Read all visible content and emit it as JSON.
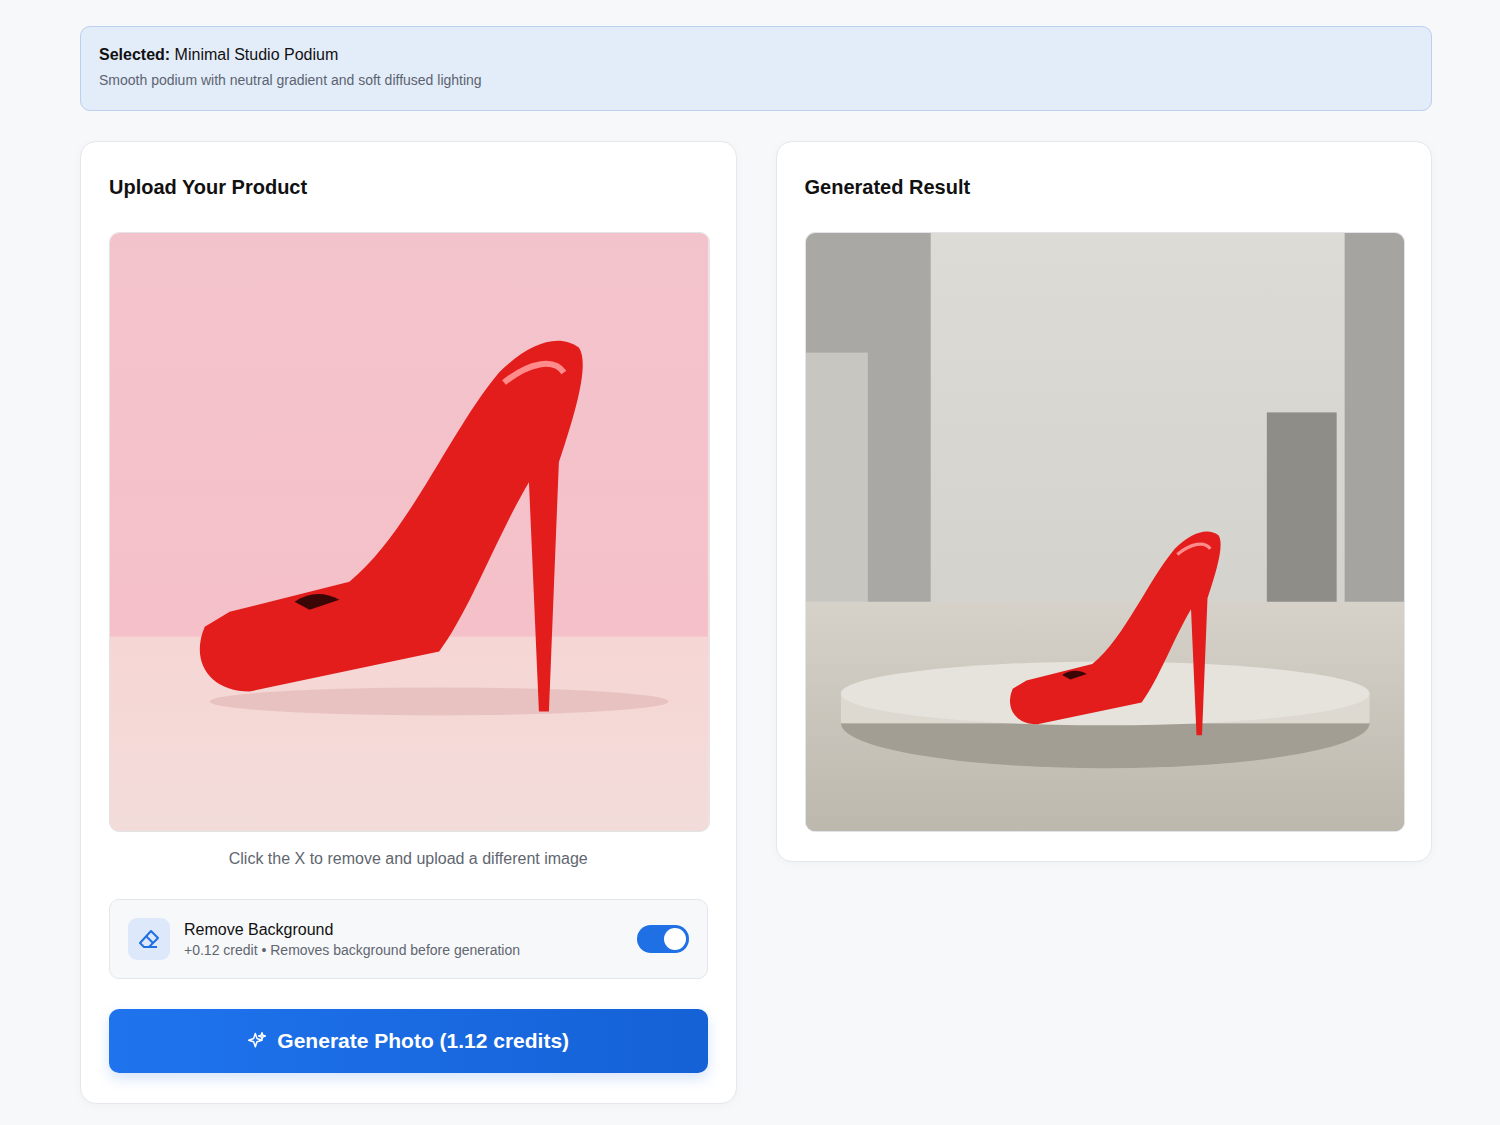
{
  "banner": {
    "label": "Selected:",
    "value": "Minimal Studio Podium",
    "description": "Smooth podium with neutral gradient and soft diffused lighting"
  },
  "upload": {
    "title": "Upload Your Product",
    "hint": "Click the X to remove and upload a different image",
    "option": {
      "title": "Remove Background",
      "detail": "+0.12 credit • Removes background before generation",
      "on": true
    },
    "button": "Generate Photo (1.12 credits)"
  },
  "result": {
    "title": "Generated Result"
  }
}
